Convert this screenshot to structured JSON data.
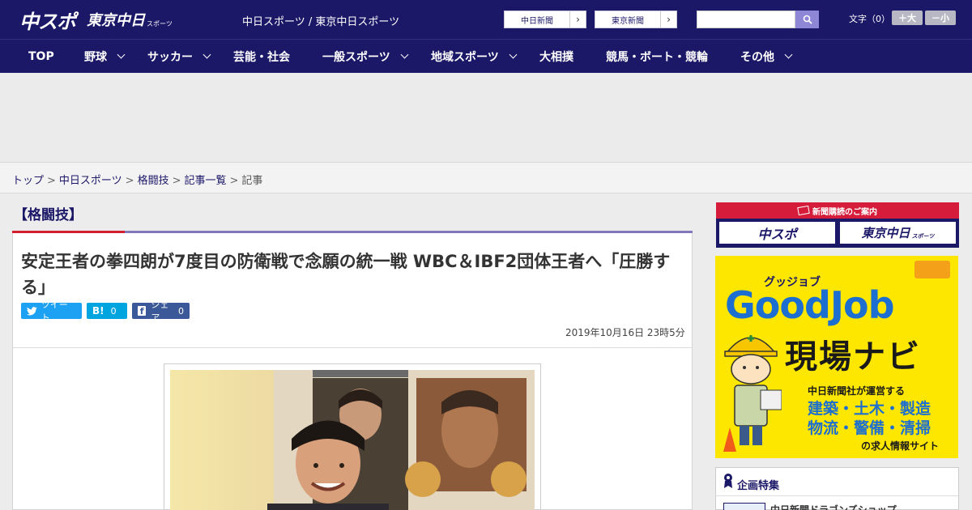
{
  "header": {
    "logo_main": "中スポ",
    "logo_sub": "東京中日",
    "logo_sub_small": "スポーツ",
    "site_title": "中日スポーツ / 東京中日スポーツ",
    "paper_links": [
      "中日新聞",
      "東京新聞"
    ],
    "font_size_label": "文字（0）",
    "font_larger": "＋大",
    "font_smaller": "－小"
  },
  "nav": {
    "items": [
      {
        "label": "TOP",
        "has_menu": false
      },
      {
        "label": "野球",
        "has_menu": true
      },
      {
        "label": "サッカー",
        "has_menu": true
      },
      {
        "label": "芸能・社会",
        "has_menu": false
      },
      {
        "label": "一般スポーツ",
        "has_menu": true
      },
      {
        "label": "地域スポーツ",
        "has_menu": true
      },
      {
        "label": "大相撲",
        "has_menu": false
      },
      {
        "label": "競馬・ボート・競輪",
        "has_menu": false
      },
      {
        "label": "その他",
        "has_menu": true
      }
    ]
  },
  "breadcrumb": {
    "items": [
      "トップ",
      "中日スポーツ",
      "格闘技",
      "記事一覧"
    ],
    "current": "記事",
    "separator": ">"
  },
  "article": {
    "category": "【格闘技】",
    "headline": "安定王者の拳四朗が7度目の防衛戦で念願の統一戦 WBC＆IBF2団体王者へ「圧勝する」",
    "share": {
      "tweet_label": "ツイート",
      "hatena_label": "B!",
      "hatena_count": "0",
      "facebook_label": "シェア",
      "facebook_count": "0"
    },
    "date": "2019年10月16日 23時5分"
  },
  "sidebar": {
    "subscription_title": "新聞購読のご案内",
    "subscription_logos": [
      "中スポ",
      "東京中日"
    ],
    "subscription_logo_small": "スポーツ",
    "ad": {
      "ruby": "グッジョブ",
      "brand": "GoodJob",
      "subtitle": "現場ナビ",
      "operator": "中日新聞社が運営する",
      "line1": "建築・土木・製造",
      "line2": "物流・警備・清掃",
      "footer": "の求人情報サイト"
    },
    "feature_title": "企画特集",
    "feature_item": "中日新聞ドラゴンズショップ"
  },
  "colors": {
    "brand_navy": "#1c1868",
    "accent_purple": "#8277b8",
    "accent_red": "#d02030",
    "twitter": "#1da1f2",
    "hatena": "#00a4de",
    "facebook": "#3b5998",
    "ad_yellow": "#fde600",
    "ad_blue": "#1c6fd0"
  }
}
